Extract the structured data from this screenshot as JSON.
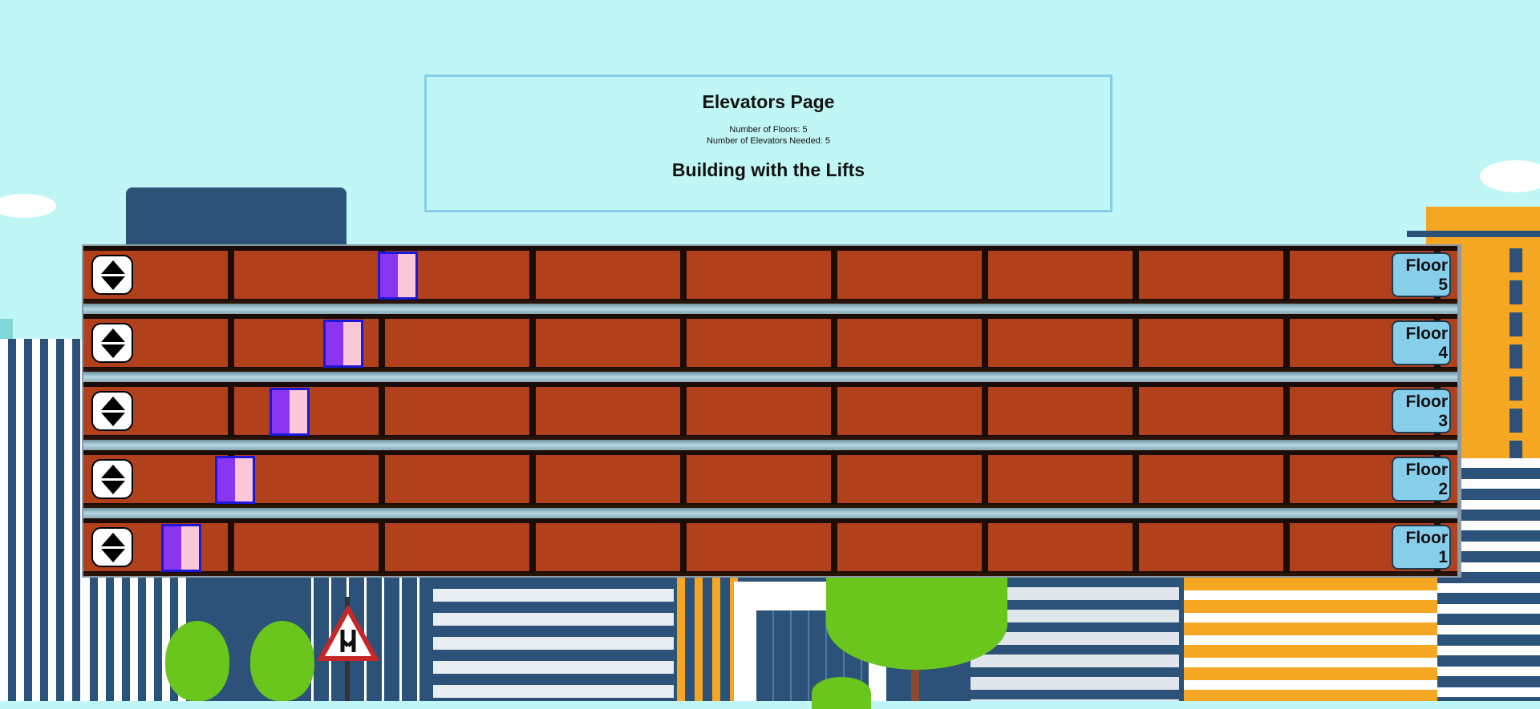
{
  "page": {
    "title": "Elevators Page",
    "floors_line": "Number of Floors: 5",
    "elevators_line": "Number of Elevators Needed: 5",
    "subtitle": "Building with the Lifts"
  },
  "floors": [
    {
      "label": "Floor 5"
    },
    {
      "label": "Floor 4"
    },
    {
      "label": "Floor 3"
    },
    {
      "label": "Floor 2"
    },
    {
      "label": "Floor 1"
    }
  ],
  "colors": {
    "sky": "#c0f6f5",
    "brick": "#b1401c",
    "elevator_border": "#1d17d8",
    "door_left": "#8a36f0",
    "door_right": "#f9c7d8",
    "label_bg": "#87ceeb"
  },
  "icons": {
    "call_button": "up-down-arrows-icon",
    "road_sign": "road-narrows-sign-icon"
  }
}
